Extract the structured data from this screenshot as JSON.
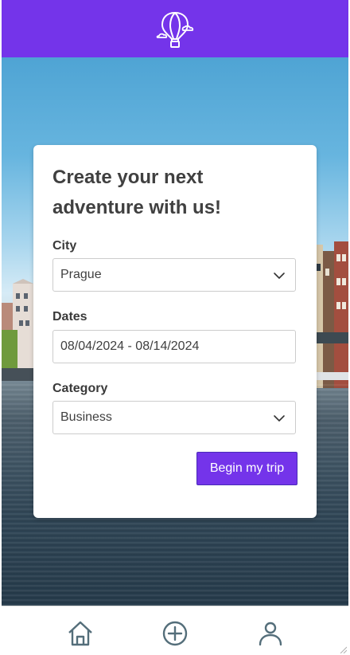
{
  "header": {
    "logo_icon": "hot-air-balloon-icon",
    "background": "#7434ea"
  },
  "form": {
    "title": "Create your next adventure with us!",
    "city": {
      "label": "City",
      "value": "Prague"
    },
    "dates": {
      "label": "Dates",
      "value": "08/04/2024 - 08/14/2024"
    },
    "category": {
      "label": "Category",
      "value": "Business"
    },
    "submit_label": "Begin my trip"
  },
  "bottom_nav": {
    "items": [
      {
        "icon": "home-icon"
      },
      {
        "icon": "add-circle-icon"
      },
      {
        "icon": "user-icon"
      }
    ]
  },
  "colors": {
    "accent": "#7434ea",
    "nav_icon": "#546e7a",
    "text": "#404040"
  }
}
